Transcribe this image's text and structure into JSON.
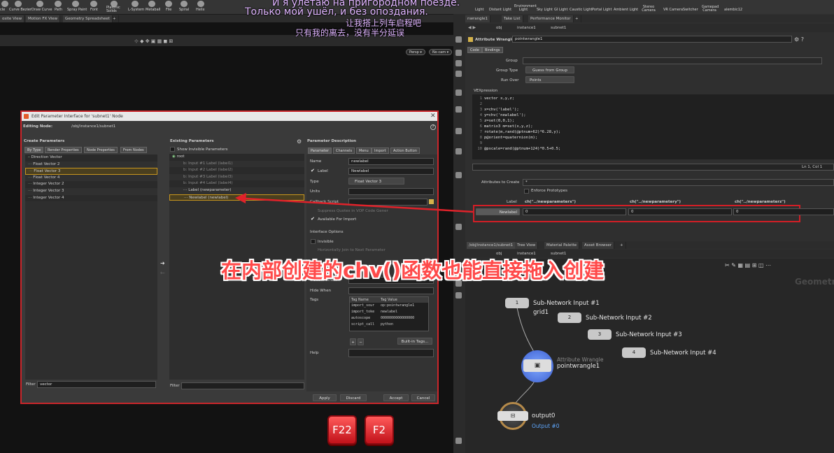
{
  "subtitles": {
    "ru_line1": "И я улетаю на пригородном поезде.",
    "ru_line2": "Только мой ушёл, и без опоздания.",
    "zh_line1": "让我搭上列车启程吧",
    "zh_line2": "只有我的离去，没有半分延误"
  },
  "annotation": "在内部创建的chv()函数也能直接拖入创建",
  "shelf_left": [
    "cle",
    "Curve Bezier",
    "Draw Curve",
    "Path",
    "Spray Paint",
    "Font",
    "Platonic Solids",
    "L-System",
    "Metaball",
    "File",
    "Spiral",
    "Helix"
  ],
  "shelf_right": [
    "Light",
    "Distant Light",
    "Environment Light",
    "Sky Light",
    "GI Light",
    "Caustic Light",
    "Portal Light",
    "Ambient Light",
    "Stereo Camera",
    "VR Camera",
    "Switcher",
    "Gamepad Camera",
    "alembic12"
  ],
  "left_tabs": [
    "osite View",
    "Motion FX View",
    "Geometry Spreadsheet",
    "+"
  ],
  "right_top_tabs": [
    "nwrangle1",
    "Take List",
    "Performance Monitor",
    "+"
  ],
  "viewport": {
    "persp": "Persp ▾",
    "cam": "No cam ▾"
  },
  "dialog": {
    "title": "Edit Parameter Interface for 'subnet1' Node",
    "editing_node_label": "Editing Node:",
    "editing_node_value": "/obj/instance1/subnet1",
    "create_params_title": "Create Parameters",
    "create_tabs": [
      "By Type",
      "Render Properties",
      "Node Properties",
      "From Nodes"
    ],
    "create_items": [
      "Direction Vector",
      "Float Vector 2",
      "Float Vector 3",
      "Float Vector 4",
      "Integer Vector 2",
      "Integer Vector 3",
      "Integer Vector 4"
    ],
    "filter_label": "Filter",
    "filter_value": "vector",
    "existing_title": "Existing Parameters",
    "show_invisible": "Show Invisible Parameters",
    "root": "root",
    "existing_items": [
      "Input #1 Label (label1)",
      "Input #2 Label (label2)",
      "Input #3 Label (label3)",
      "Input #4 Label (label4)",
      "Label (newparameter)",
      "Newlabel (newlabel)"
    ],
    "filter2_label": "Filter",
    "desc_title": "Parameter Description",
    "desc_tabs": [
      "Parameter",
      "Channels",
      "Menu",
      "Import",
      "Action Button"
    ],
    "name_label": "Name",
    "name_value": "newlabel",
    "label_label": "Label",
    "label_value": "Newlabel",
    "type_label": "Type",
    "type_value": "Float Vector 3",
    "units_label": "Units",
    "callback_label": "Callback Script",
    "suppress": "Suppress Quotes in VOP Code Gener",
    "available": "Available For Import",
    "iface_opts": "Interface Options",
    "invisible": "Invisible",
    "horiz_join": "Horizontally Join to Next Parameter",
    "disable_when": "Disable When",
    "hide_when": "Hide When",
    "tags_label": "Tags",
    "tag_headers": [
      "Tag Name",
      "Tag Value"
    ],
    "tags": [
      [
        "import_sour",
        "op:pointwrangle1"
      ],
      [
        "import_toke",
        "newlabel"
      ],
      [
        "autoscope",
        "0000000000000000"
      ],
      [
        "script_call",
        "python"
      ]
    ],
    "builtin_tags": "Built-in Tags...",
    "help_label": "Help",
    "buttons": [
      "Apply",
      "Discard",
      "Accept",
      "Cancel"
    ]
  },
  "right_pane": {
    "path": [
      "obj",
      "instance1",
      "subnet1"
    ],
    "node_type": "Attribute Wrangle",
    "node_name": "pointwrangle1",
    "tabs": [
      "Code",
      "Bindings"
    ],
    "group_label": "Group",
    "group_type_label": "Group Type",
    "group_type_value": "Guess from Group",
    "run_over_label": "Run Over",
    "run_over_value": "Points",
    "vex_label": "VEXpression",
    "code": [
      "vector x,y,z;",
      "",
      "x=chv('label');",
      "y=chv('newlabel');",
      "z=set(0,0,1);",
      "matrix3 m=set(x,y,z);",
      "rotate(m,rand(@ptnum+62)*6.28,y);",
      "p@orient=quaternion(m);",
      "",
      "@pscale=rand(@ptnum+124)*0.5+0.5;"
    ],
    "cursor_pos": "Ln 1, Col 1",
    "attr_create_label": "Attributes to Create",
    "attr_create_value": "*",
    "enforce": "Enforce Prototypes",
    "label_label": "Label",
    "ch_values": [
      "ch(\"../newparameterx\")",
      "ch(\"../newparametery\")",
      "ch(\"../newparameterz\")"
    ],
    "newlabel_btn": "Newlabel",
    "newlabel_values": [
      "0",
      "0",
      "0"
    ],
    "lower_tabs": [
      "/obj/instance1/subnet1",
      "Tree View",
      "Material Palette",
      "Asset Browser",
      "+"
    ],
    "lower_path": [
      "obj",
      "instance1",
      "subnet1"
    ],
    "geometry_watermark": "Geometry"
  },
  "network": {
    "nodes": [
      {
        "num": "1",
        "label": "Sub-Network Input #1",
        "sub": "grid1"
      },
      {
        "num": "2",
        "label": "Sub-Network Input #2"
      },
      {
        "num": "3",
        "label": "Sub-Network Input #3"
      },
      {
        "num": "4",
        "label": "Sub-Network Input #4"
      }
    ],
    "wrangle_type": "Attribute Wrangle",
    "wrangle_name": "pointwrangle1",
    "output_name": "output0",
    "output_sub": "Output #0"
  },
  "fkeys": [
    "F22",
    "F2"
  ],
  "colors": {
    "annotation_red": "#ff4a4a",
    "dialog_border": "#c9262b",
    "subtitle": "#e0b5ff",
    "highlight_row": "#5a4a1a",
    "output_label": "#5fa8ff"
  }
}
